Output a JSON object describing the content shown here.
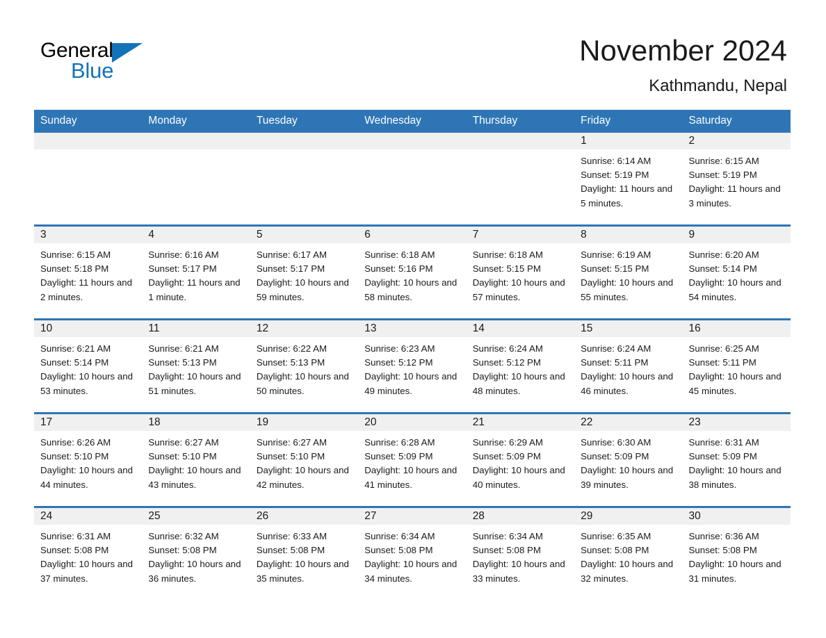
{
  "brand": {
    "name_part1": "General",
    "name_part2": "Blue",
    "triangle_color": "#1373b9"
  },
  "header": {
    "month_title": "November 2024",
    "location": "Kathmandu, Nepal"
  },
  "colors": {
    "header_blue": "#2e75b6",
    "row_divider_blue": "#2e75b6",
    "daynum_band": "#f0f0f0",
    "text": "#1a1a1a"
  },
  "weekday_headers": [
    "Sunday",
    "Monday",
    "Tuesday",
    "Wednesday",
    "Thursday",
    "Friday",
    "Saturday"
  ],
  "weeks": [
    [
      {
        "day": "",
        "sunrise": "",
        "sunset": "",
        "daylight": ""
      },
      {
        "day": "",
        "sunrise": "",
        "sunset": "",
        "daylight": ""
      },
      {
        "day": "",
        "sunrise": "",
        "sunset": "",
        "daylight": ""
      },
      {
        "day": "",
        "sunrise": "",
        "sunset": "",
        "daylight": ""
      },
      {
        "day": "",
        "sunrise": "",
        "sunset": "",
        "daylight": ""
      },
      {
        "day": "1",
        "sunrise": "Sunrise: 6:14 AM",
        "sunset": "Sunset: 5:19 PM",
        "daylight": "Daylight: 11 hours and 5 minutes."
      },
      {
        "day": "2",
        "sunrise": "Sunrise: 6:15 AM",
        "sunset": "Sunset: 5:19 PM",
        "daylight": "Daylight: 11 hours and 3 minutes."
      }
    ],
    [
      {
        "day": "3",
        "sunrise": "Sunrise: 6:15 AM",
        "sunset": "Sunset: 5:18 PM",
        "daylight": "Daylight: 11 hours and 2 minutes."
      },
      {
        "day": "4",
        "sunrise": "Sunrise: 6:16 AM",
        "sunset": "Sunset: 5:17 PM",
        "daylight": "Daylight: 11 hours and 1 minute."
      },
      {
        "day": "5",
        "sunrise": "Sunrise: 6:17 AM",
        "sunset": "Sunset: 5:17 PM",
        "daylight": "Daylight: 10 hours and 59 minutes."
      },
      {
        "day": "6",
        "sunrise": "Sunrise: 6:18 AM",
        "sunset": "Sunset: 5:16 PM",
        "daylight": "Daylight: 10 hours and 58 minutes."
      },
      {
        "day": "7",
        "sunrise": "Sunrise: 6:18 AM",
        "sunset": "Sunset: 5:15 PM",
        "daylight": "Daylight: 10 hours and 57 minutes."
      },
      {
        "day": "8",
        "sunrise": "Sunrise: 6:19 AM",
        "sunset": "Sunset: 5:15 PM",
        "daylight": "Daylight: 10 hours and 55 minutes."
      },
      {
        "day": "9",
        "sunrise": "Sunrise: 6:20 AM",
        "sunset": "Sunset: 5:14 PM",
        "daylight": "Daylight: 10 hours and 54 minutes."
      }
    ],
    [
      {
        "day": "10",
        "sunrise": "Sunrise: 6:21 AM",
        "sunset": "Sunset: 5:14 PM",
        "daylight": "Daylight: 10 hours and 53 minutes."
      },
      {
        "day": "11",
        "sunrise": "Sunrise: 6:21 AM",
        "sunset": "Sunset: 5:13 PM",
        "daylight": "Daylight: 10 hours and 51 minutes."
      },
      {
        "day": "12",
        "sunrise": "Sunrise: 6:22 AM",
        "sunset": "Sunset: 5:13 PM",
        "daylight": "Daylight: 10 hours and 50 minutes."
      },
      {
        "day": "13",
        "sunrise": "Sunrise: 6:23 AM",
        "sunset": "Sunset: 5:12 PM",
        "daylight": "Daylight: 10 hours and 49 minutes."
      },
      {
        "day": "14",
        "sunrise": "Sunrise: 6:24 AM",
        "sunset": "Sunset: 5:12 PM",
        "daylight": "Daylight: 10 hours and 48 minutes."
      },
      {
        "day": "15",
        "sunrise": "Sunrise: 6:24 AM",
        "sunset": "Sunset: 5:11 PM",
        "daylight": "Daylight: 10 hours and 46 minutes."
      },
      {
        "day": "16",
        "sunrise": "Sunrise: 6:25 AM",
        "sunset": "Sunset: 5:11 PM",
        "daylight": "Daylight: 10 hours and 45 minutes."
      }
    ],
    [
      {
        "day": "17",
        "sunrise": "Sunrise: 6:26 AM",
        "sunset": "Sunset: 5:10 PM",
        "daylight": "Daylight: 10 hours and 44 minutes."
      },
      {
        "day": "18",
        "sunrise": "Sunrise: 6:27 AM",
        "sunset": "Sunset: 5:10 PM",
        "daylight": "Daylight: 10 hours and 43 minutes."
      },
      {
        "day": "19",
        "sunrise": "Sunrise: 6:27 AM",
        "sunset": "Sunset: 5:10 PM",
        "daylight": "Daylight: 10 hours and 42 minutes."
      },
      {
        "day": "20",
        "sunrise": "Sunrise: 6:28 AM",
        "sunset": "Sunset: 5:09 PM",
        "daylight": "Daylight: 10 hours and 41 minutes."
      },
      {
        "day": "21",
        "sunrise": "Sunrise: 6:29 AM",
        "sunset": "Sunset: 5:09 PM",
        "daylight": "Daylight: 10 hours and 40 minutes."
      },
      {
        "day": "22",
        "sunrise": "Sunrise: 6:30 AM",
        "sunset": "Sunset: 5:09 PM",
        "daylight": "Daylight: 10 hours and 39 minutes."
      },
      {
        "day": "23",
        "sunrise": "Sunrise: 6:31 AM",
        "sunset": "Sunset: 5:09 PM",
        "daylight": "Daylight: 10 hours and 38 minutes."
      }
    ],
    [
      {
        "day": "24",
        "sunrise": "Sunrise: 6:31 AM",
        "sunset": "Sunset: 5:08 PM",
        "daylight": "Daylight: 10 hours and 37 minutes."
      },
      {
        "day": "25",
        "sunrise": "Sunrise: 6:32 AM",
        "sunset": "Sunset: 5:08 PM",
        "daylight": "Daylight: 10 hours and 36 minutes."
      },
      {
        "day": "26",
        "sunrise": "Sunrise: 6:33 AM",
        "sunset": "Sunset: 5:08 PM",
        "daylight": "Daylight: 10 hours and 35 minutes."
      },
      {
        "day": "27",
        "sunrise": "Sunrise: 6:34 AM",
        "sunset": "Sunset: 5:08 PM",
        "daylight": "Daylight: 10 hours and 34 minutes."
      },
      {
        "day": "28",
        "sunrise": "Sunrise: 6:34 AM",
        "sunset": "Sunset: 5:08 PM",
        "daylight": "Daylight: 10 hours and 33 minutes."
      },
      {
        "day": "29",
        "sunrise": "Sunrise: 6:35 AM",
        "sunset": "Sunset: 5:08 PM",
        "daylight": "Daylight: 10 hours and 32 minutes."
      },
      {
        "day": "30",
        "sunrise": "Sunrise: 6:36 AM",
        "sunset": "Sunset: 5:08 PM",
        "daylight": "Daylight: 10 hours and 31 minutes."
      }
    ]
  ]
}
